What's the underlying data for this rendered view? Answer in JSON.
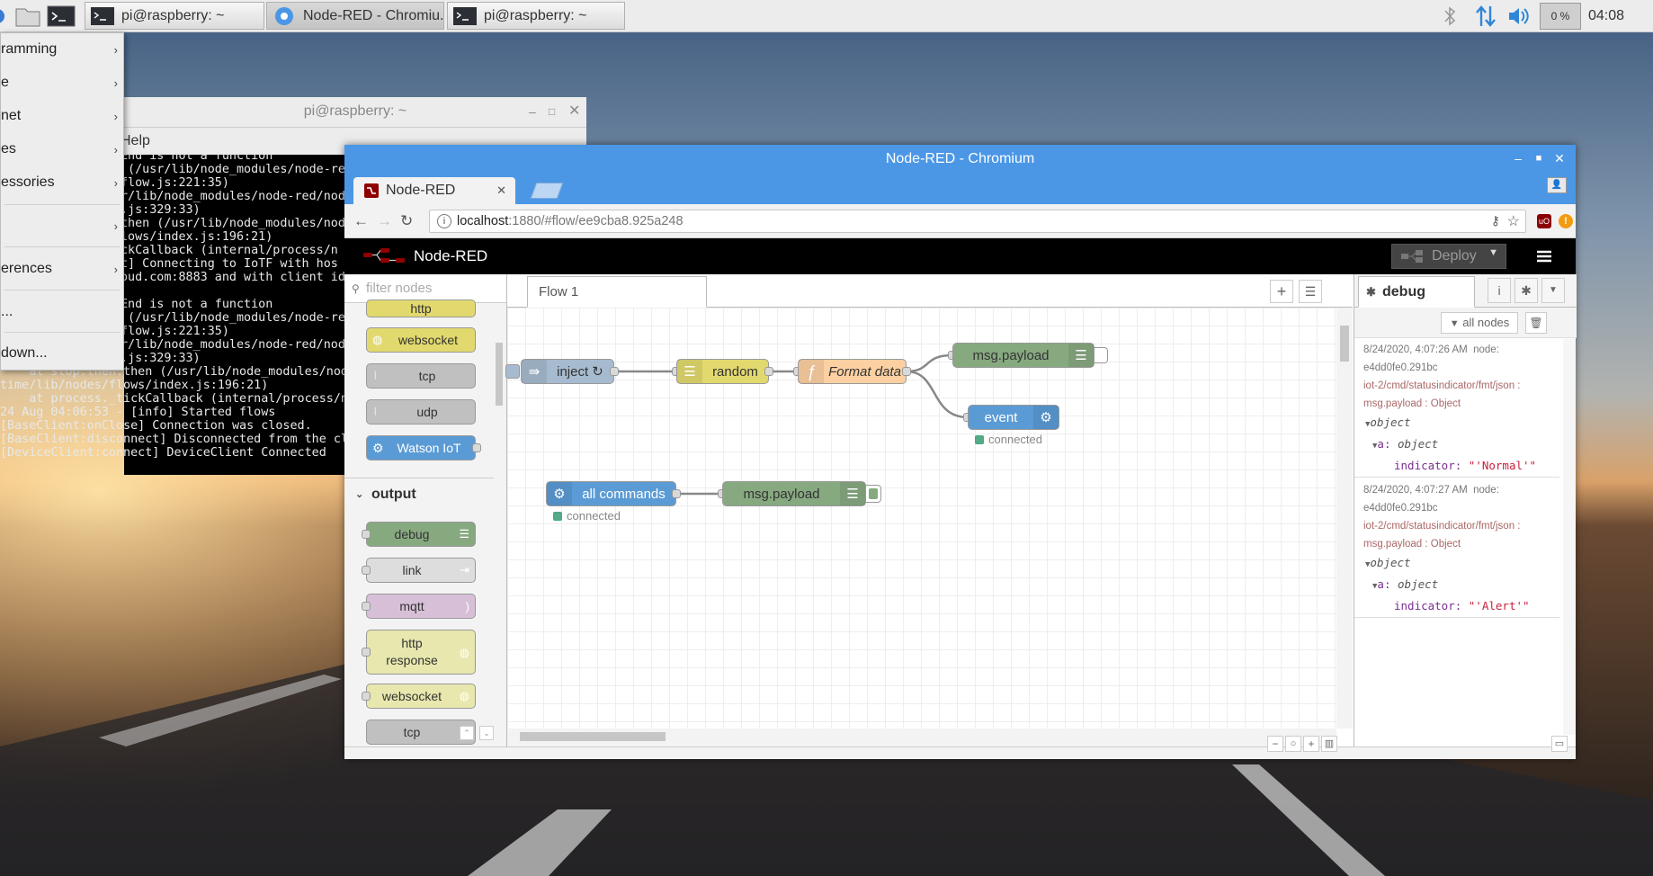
{
  "taskbar": {
    "windows": [
      {
        "label": "pi@raspberry: ~"
      },
      {
        "label": "Node-RED - Chromiu..."
      },
      {
        "label": "pi@raspberry: ~"
      }
    ],
    "cpu": "0 %",
    "clock": "04:08"
  },
  "menu": {
    "items": [
      "ramming",
      "e",
      "net",
      "es",
      "essories",
      "",
      "erences",
      "...",
      "down..."
    ]
  },
  "terminal": {
    "title": "pi@raspberry: ~",
    "menu_help": "Help",
    "lines": [
      "End is not a function",
      " (/usr/lib/node_modules/node-re",
      "flow.js:221:35)",
      "r/lib/node_modules/node-red/nod",
      ".js:329:33)",
      "then (/usr/lib/node_modules/nod",
      "lows/index.js:196:21)",
      "ckCallback (internal/process/n",
      "t] Connecting to IoTF with hos",
      "oud.com:8883 and with client id",
      "",
      "End is not a function",
      " (/usr/lib/node_modules/node-re",
      "flow.js:221:35)",
      "r/lib/node_modules/node-red/nod",
      ".js:329:33)",
      "    at stop.then.then (/usr/lib/node_modules/nod",
      "time/lib/nodes/flows/index.js:196:21)",
      "    at process._tickCallback (internal/process/n",
      "24 Aug 04:06:53 - [info] Started flows",
      "[BaseClient:onClose] Connection was closed.",
      "[BaseClient:disconnect] Disconnected from the cl",
      "[DeviceClient:connect] DeviceClient Connected"
    ]
  },
  "browser": {
    "window_title": "Node-RED - Chromium",
    "tab_title": "Node-RED",
    "url_host": "localhost",
    "url_rest": ":1880/#flow/ee9cba8.925a248"
  },
  "nodered": {
    "title": "Node-RED",
    "deploy_label": "Deploy",
    "filter_placeholder": "filter nodes",
    "palette_top": [
      "http",
      "websocket",
      "tcp",
      "udp",
      "Watson IoT"
    ],
    "output_category": "output",
    "palette_output": [
      "debug",
      "link",
      "mqtt",
      "http response",
      "websocket",
      "tcp"
    ],
    "flow_tab": "Flow 1",
    "nodes": {
      "inject": "inject ↻",
      "random": "random",
      "format": "Format data",
      "payload1": "msg.payload",
      "event": "event",
      "event_status": "connected",
      "allcommands": "all commands",
      "allcommands_status": "connected",
      "payload2": "msg.payload"
    },
    "sidebar": {
      "tab": "debug",
      "filter": "all nodes",
      "messages": [
        {
          "time": "8/24/2020, 4:07:26 AM",
          "node": "node:",
          "node_id": "e4dd0fe0.291bc",
          "topic": "iot-2/cmd/statusindicator/fmt/json :",
          "type": "msg.payload : Object",
          "obj": "object",
          "key_a": "a:",
          "val_a": "object",
          "key_ind": "indicator:",
          "val_ind": "\"'Normal'\""
        },
        {
          "time": "8/24/2020, 4:07:27 AM",
          "node": "node:",
          "node_id": "e4dd0fe0.291bc",
          "topic": "iot-2/cmd/statusindicator/fmt/json :",
          "type": "msg.payload : Object",
          "obj": "object",
          "key_a": "a:",
          "val_a": "object",
          "key_ind": "indicator:",
          "val_ind": "\"'Alert'\""
        }
      ]
    }
  },
  "colors": {
    "titlebar": "#4b97e6",
    "node_inject": "#a6bbcf",
    "node_function": "#fdd0a2",
    "node_random": "#e2d96e",
    "node_debug": "#87a980",
    "node_watson": "#5b9bd5"
  }
}
